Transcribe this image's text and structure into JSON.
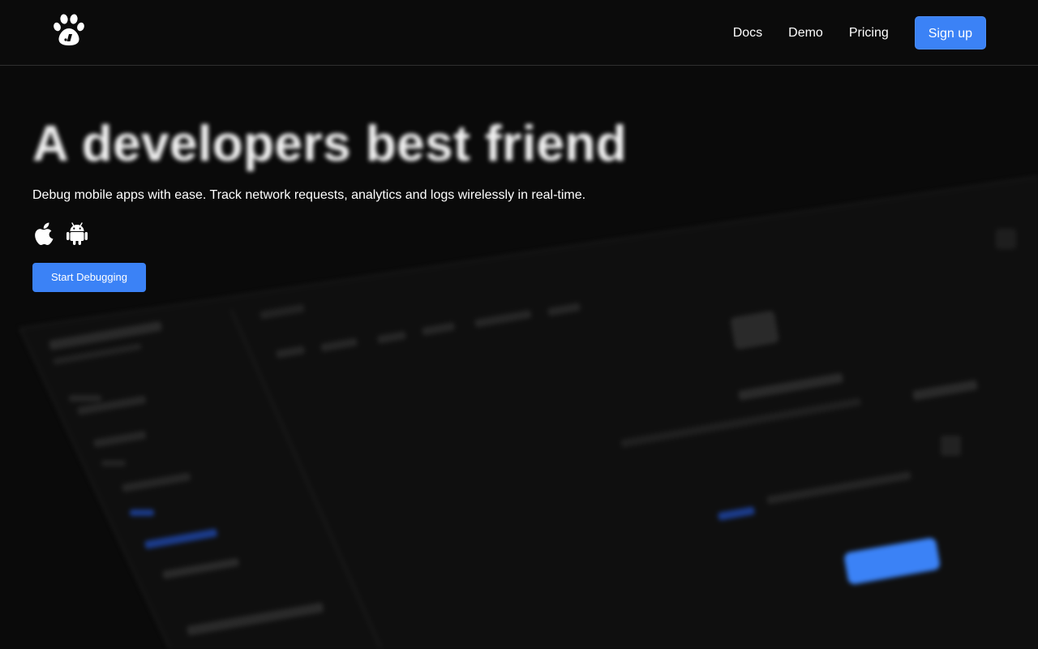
{
  "header": {
    "logo_icon": "paw-icon",
    "nav": [
      {
        "label": "Docs"
      },
      {
        "label": "Demo"
      },
      {
        "label": "Pricing"
      }
    ],
    "signup_label": "Sign up"
  },
  "hero": {
    "title": "A developers best friend",
    "subtitle": "Debug mobile apps with ease. Track network requests, analytics and logs wirelessly in real-time.",
    "platforms": [
      {
        "icon": "apple-icon"
      },
      {
        "icon": "android-icon"
      }
    ],
    "cta_label": "Start Debugging"
  },
  "colors": {
    "background": "#0a0a0a",
    "accent": "#3b82f6",
    "text": "#ffffff"
  }
}
